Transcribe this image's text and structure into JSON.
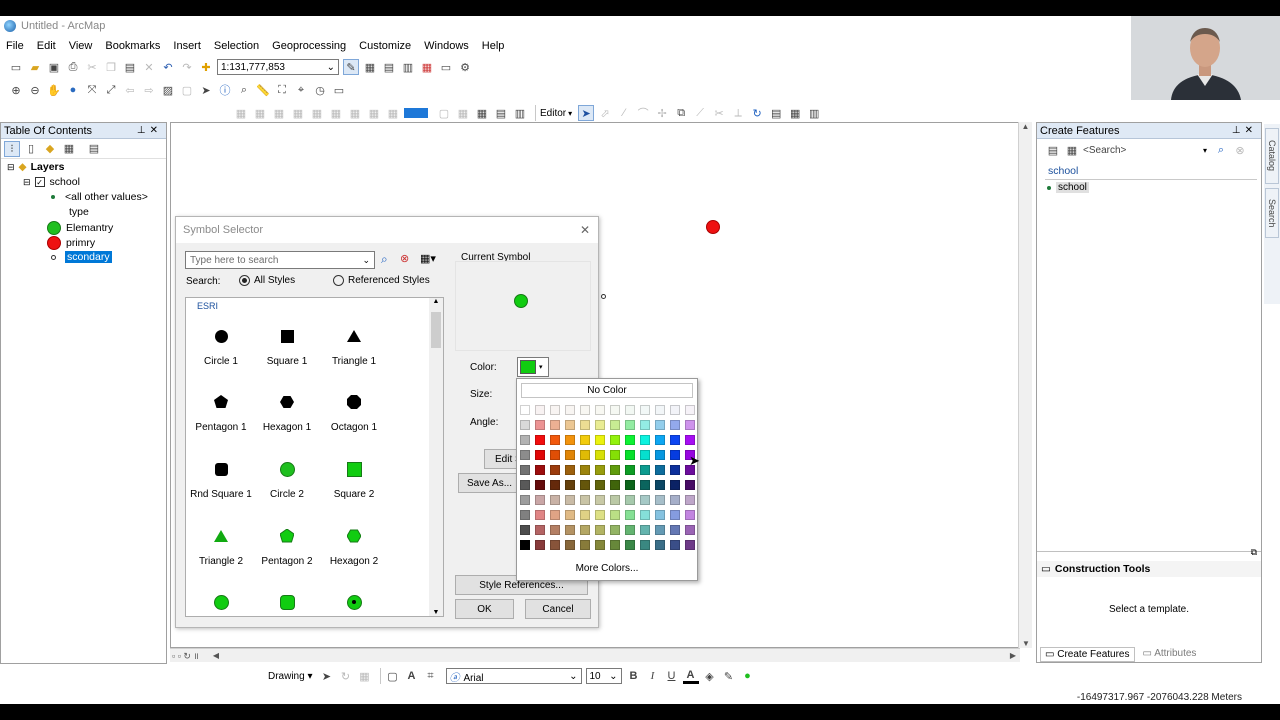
{
  "window": {
    "title": "Untitled - ArcMap"
  },
  "menu": [
    "File",
    "Edit",
    "View",
    "Bookmarks",
    "Insert",
    "Selection",
    "Geoprocessing",
    "Customize",
    "Windows",
    "Help"
  ],
  "toolbar": {
    "scale": "1:131,777,853",
    "editor_label": "Editor"
  },
  "toc": {
    "title": "Table Of Contents",
    "layers_label": "Layers",
    "layer_name": "school",
    "rows": [
      "<all other values>",
      "type",
      "Elemantry",
      "primry",
      "scondary"
    ],
    "colors": {
      "elemantry": "#1fbf1f",
      "primry": "#ee1111"
    }
  },
  "symbol_selector": {
    "title": "Symbol Selector",
    "search_placeholder": "Type here to search",
    "search_label": "Search:",
    "all_styles": "All Styles",
    "referenced_styles": "Referenced Styles",
    "group": "ESRI",
    "current_symbol": "Current Symbol",
    "color_label": "Color:",
    "size_label": "Size:",
    "angle_label": "Angle:",
    "edit_symbol": "Edit S",
    "save_as": "Save As...",
    "style_references": "Style References...",
    "ok": "OK",
    "cancel": "Cancel",
    "current_color": "#11cc11",
    "symbols": [
      "Circle 1",
      "Square 1",
      "Triangle 1",
      "Pentagon 1",
      "Hexagon 1",
      "Octagon 1",
      "Rnd Square 1",
      "Circle 2",
      "Square 2",
      "Triangle 2",
      "Pentagon 2",
      "Hexagon 2"
    ]
  },
  "palette": {
    "no_color": "No Color",
    "more_colors": "More Colors..."
  },
  "create_features": {
    "title": "Create Features",
    "search_placeholder": "<Search>",
    "group": "school",
    "item": "school"
  },
  "construction_tools": {
    "title": "Construction Tools",
    "message": "Select a template."
  },
  "tabs": {
    "create_features": "Create Features",
    "attributes": "Attributes"
  },
  "side_tabs": {
    "catalog": "Catalog",
    "search": "Search"
  },
  "drawing": {
    "label": "Drawing",
    "font": "Arial",
    "font_size": "10"
  },
  "status": {
    "coords": "-16497317.967  -2076043.228 Meters"
  }
}
